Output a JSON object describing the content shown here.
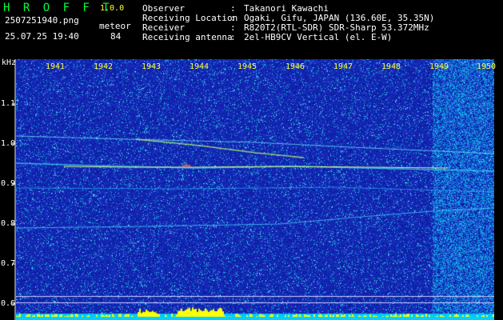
{
  "header": {
    "app_name": "H R O F F T",
    "version": "1.0.0",
    "filename": "2507251940.png",
    "datetime": "25.07.25 19:40",
    "meteor_label": "meteor",
    "meteor_count": "84"
  },
  "station": [
    {
      "label": "Observer",
      "value": "Takanori Kawachi"
    },
    {
      "label": "Receiving Location",
      "value": "Ogaki, Gifu, JAPAN (136.60E, 35.35N)"
    },
    {
      "label": "Receiver",
      "value": "R820T2(RTL-SDR) SDR-Sharp 53.372MHz"
    },
    {
      "label": "Receiving antenna",
      "value": "2el-HB9CV Vertical (el. E-W)"
    }
  ],
  "axis": {
    "y_unit": "kHz",
    "y_ticks": [
      "1.1",
      "1.0",
      "0.9",
      "0.8",
      "0.7",
      "0.6"
    ],
    "x_ticks": [
      "1941",
      "1942",
      "1943",
      "1944",
      "1945",
      "1946",
      "1947",
      "1948",
      "1949",
      "1950"
    ]
  },
  "colors": {
    "background": "#000000",
    "plot_base": "#1b2fb8",
    "header_text": "#00ff3a",
    "info_text": "#ffffff",
    "tick_text": "#ffff33",
    "signal_bars": "#ffff00",
    "noise_floor": "#00c8ff"
  }
}
